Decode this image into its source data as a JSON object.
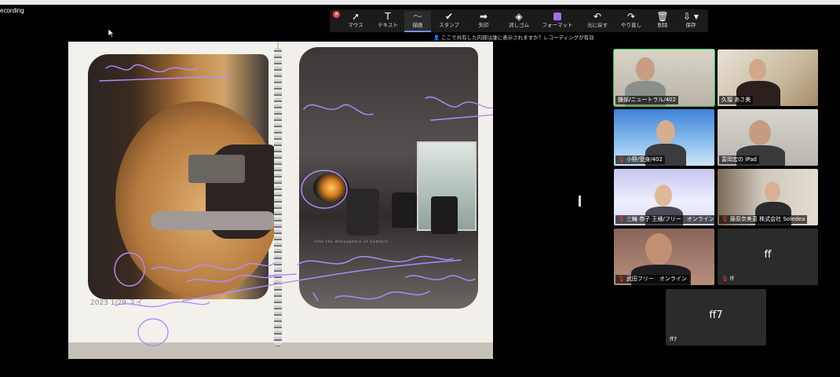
{
  "recording": {
    "label": "ecording"
  },
  "toolbar": {
    "tools": [
      {
        "icon": "mouse-cursor-icon",
        "glyph": "➚",
        "label": "マウス"
      },
      {
        "icon": "text-icon",
        "glyph": "T",
        "label": "テキスト"
      },
      {
        "icon": "draw-icon",
        "glyph": "〜",
        "label": "描画",
        "active": true
      },
      {
        "icon": "stamp-icon",
        "glyph": "✔",
        "label": "スタンプ"
      },
      {
        "icon": "arrow-icon",
        "glyph": "➡",
        "label": "矢印"
      },
      {
        "icon": "eraser-icon",
        "glyph": "◈",
        "label": "消しゴム"
      },
      {
        "icon": "format-icon",
        "glyph": "",
        "label": "フォーマット"
      },
      {
        "icon": "undo-icon",
        "glyph": "↶",
        "label": "元に戻す"
      },
      {
        "icon": "redo-icon",
        "glyph": "↷",
        "label": "やり直し"
      },
      {
        "icon": "trash-icon",
        "glyph": "🗑",
        "label": "削除"
      },
      {
        "icon": "save-icon",
        "glyph": "⇩ ▾",
        "label": "保存"
      }
    ],
    "share_note": "ここで共有した内容は誰に表示されますか？レコーディングが有効",
    "format_color": "#a36ee6"
  },
  "shared": {
    "ink_color": "#b28cff",
    "room_caption": "Into the Atmosphere of Comfort",
    "handwritten_note": "2023 1/29 スイ"
  },
  "participants": [
    {
      "name": "鎌部/ニュートラル/402",
      "muted": false,
      "speaking": true,
      "kind": "video"
    },
    {
      "name": "久瑠 あさ美",
      "muted": false,
      "speaking": false,
      "kind": "video"
    },
    {
      "name": "小野/受身/402",
      "muted": true,
      "speaking": false,
      "kind": "video"
    },
    {
      "name": "富岡宏の iPad",
      "muted": false,
      "speaking": false,
      "kind": "video"
    },
    {
      "name": "三輪 恭子 王様/フリー　オンライン",
      "muted": true,
      "speaking": false,
      "kind": "video"
    },
    {
      "name": "藤原奈美恵 株式会社 Soledea",
      "muted": true,
      "speaking": false,
      "kind": "video"
    },
    {
      "name": "武田フリー　オンライン",
      "muted": true,
      "speaking": false,
      "kind": "video"
    },
    {
      "name": "ff",
      "muted": true,
      "speaking": false,
      "kind": "avatar",
      "initials": "ff"
    },
    {
      "name": "ff7",
      "muted": false,
      "speaking": false,
      "kind": "avatar",
      "initials": "ff7"
    }
  ]
}
